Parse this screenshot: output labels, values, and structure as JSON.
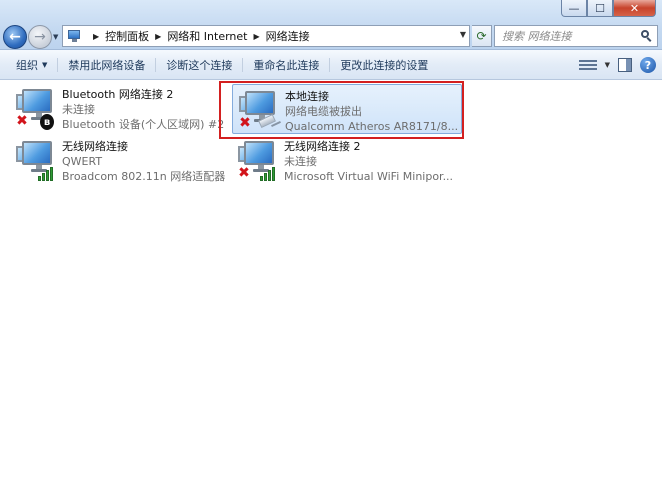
{
  "window": {
    "minimize_glyph": "—",
    "maximize_glyph": "☐",
    "close_glyph": "✕"
  },
  "nav": {
    "back_glyph": "←",
    "forward_glyph": "→",
    "history_glyph": "▼"
  },
  "address": {
    "icon": "control-panel-icon",
    "crumbs": [
      "控制面板",
      "网络和 Internet",
      "网络连接"
    ],
    "separator": "▶",
    "dropdown_glyph": "▼",
    "refresh_glyph": "⟳"
  },
  "search": {
    "placeholder": "搜索 网络连接",
    "value": ""
  },
  "toolbar": {
    "organize_label": "组织",
    "organize_dropdown_glyph": "▼",
    "disable_label": "禁用此网络设备",
    "diagnose_label": "诊断这个连接",
    "rename_label": "重命名此连接",
    "change_settings_label": "更改此连接的设置",
    "view_dropdown_glyph": "▼",
    "help_glyph": "?"
  },
  "connections": [
    {
      "name": "Bluetooth 网络连接 2",
      "status": "未连接",
      "device": "Bluetooth 设备(个人区域网) #2",
      "badge_icon": "bluetooth-icon",
      "badge_glyph": "ʙ",
      "disconnected": true,
      "selected": false
    },
    {
      "name": "本地连接",
      "status": "网络电缆被拔出",
      "device": "Qualcomm Atheros AR8171/8...",
      "badge_icon": "network-cable-icon",
      "disconnected": true,
      "selected": true
    },
    {
      "name": "无线网络连接",
      "status": "QWERT",
      "device": "Broadcom 802.11n 网络适配器",
      "badge_icon": "wifi-signal-icon",
      "disconnected": false,
      "selected": false
    },
    {
      "name": "无线网络连接 2",
      "status": "未连接",
      "device": "Microsoft Virtual WiFi Minipor...",
      "badge_icon": "wifi-signal-icon",
      "disconnected": true,
      "selected": false
    }
  ],
  "colors": {
    "highlight_border": "#d32020",
    "selection_fill": "#cfe3f9",
    "disconnected_x": "#d2141b",
    "signal_green": "#2f9d36"
  }
}
